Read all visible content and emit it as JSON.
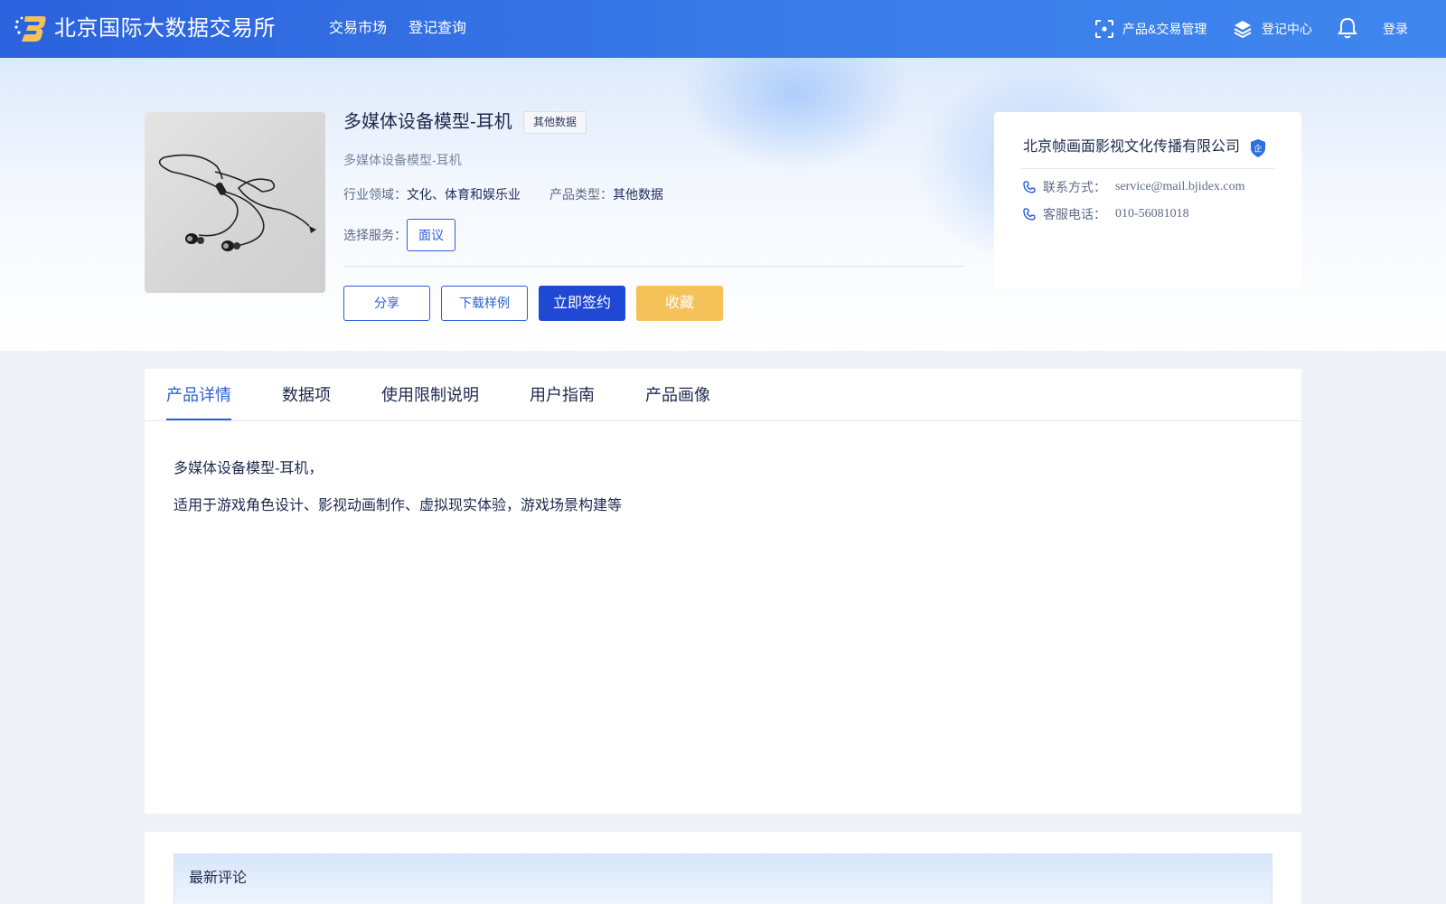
{
  "header": {
    "brand": "北京国际大数据交易所",
    "nav": {
      "market": "交易市场",
      "query": "登记查询"
    },
    "right": {
      "manage": "产品&交易管理",
      "register_center": "登记中心",
      "login": "登录"
    },
    "icons": [
      "logo",
      "scan-icon",
      "layers-icon",
      "bell-icon"
    ]
  },
  "product": {
    "title": "多媒体设备模型-耳机",
    "tag": "其他数据",
    "subtitle": "多媒体设备模型-耳机",
    "industry_label": "行业领域：",
    "industry_value": "文化、体育和娱乐业",
    "type_label": "产品类型：",
    "type_value": "其他数据",
    "service_label": "选择服务：",
    "service_option": "面议",
    "buttons": {
      "share": "分享",
      "sample": "下载样例",
      "sign": "立即签约",
      "favorite": "收藏"
    }
  },
  "company": {
    "name": "北京帧画面影视文化传播有限公司",
    "badge": "企",
    "contact_label": "联系方式：",
    "contact_value": "service@mail.bjidex.com",
    "phone_label": "客服电话：",
    "phone_value": "010-56081018"
  },
  "tabs": [
    {
      "label": "产品详情",
      "active": true
    },
    {
      "label": "数据项",
      "active": false
    },
    {
      "label": "使用限制说明",
      "active": false
    },
    {
      "label": "用户指南",
      "active": false
    },
    {
      "label": "产品画像",
      "active": false
    }
  ],
  "detail": {
    "line1": "多媒体设备模型-耳机，",
    "line2": "适用于游戏角色设计、影视动画制作、虚拟现实体验，游戏场景构建等"
  },
  "comments": {
    "title": "最新评论"
  },
  "colors": {
    "primary": "#2d5fd6",
    "sign_button": "#1f49d4",
    "favorite_button": "#f5c259",
    "topbar_start": "#2b62dd",
    "topbar_end": "#3f86ee"
  }
}
